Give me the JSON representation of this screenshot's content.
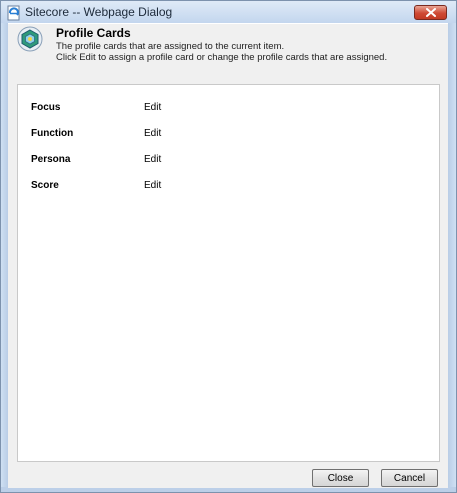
{
  "window": {
    "title": "Sitecore -- Webpage Dialog"
  },
  "header": {
    "title": "Profile Cards",
    "description_line1": "The profile cards that are assigned to the current item.",
    "description_line2": "Click Edit to assign a profile card or change the profile cards that are assigned."
  },
  "profiles": [
    {
      "label": "Focus",
      "action": "Edit"
    },
    {
      "label": "Function",
      "action": "Edit"
    },
    {
      "label": "Persona",
      "action": "Edit"
    },
    {
      "label": "Score",
      "action": "Edit"
    }
  ],
  "buttons": {
    "close": "Close",
    "cancel": "Cancel"
  },
  "colors": {
    "title_bar": "#c3d6ee",
    "close_button": "#cf4a35",
    "dialog_background": "#f0f0f0"
  },
  "icons": {
    "window": "ie-page-icon",
    "header": "profile-cards-hexagon-icon",
    "close": "close-x-icon"
  }
}
